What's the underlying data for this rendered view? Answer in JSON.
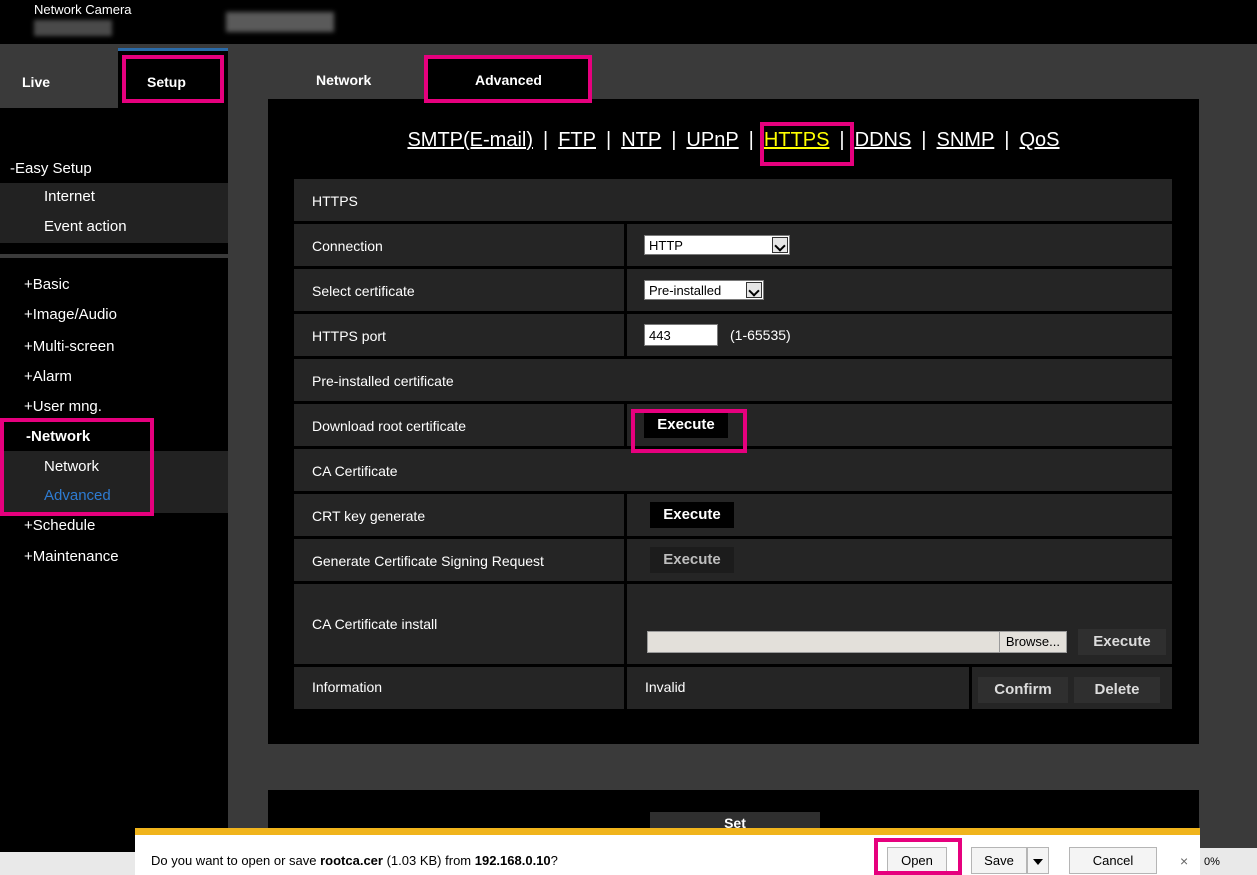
{
  "header": {
    "app_title": "Network Camera"
  },
  "sidebar": {
    "tab_live": "Live",
    "tab_setup": "Setup",
    "easy_setup": "-Easy Setup",
    "easy_items": [
      "Internet",
      "Event action"
    ],
    "menu": [
      "+Basic",
      "+Image/Audio",
      "+Multi-screen",
      "+Alarm",
      "+User mng.",
      "-Network"
    ],
    "network_sub": [
      "Network",
      "Advanced"
    ],
    "menu_after": [
      "+Schedule",
      "+Maintenance"
    ]
  },
  "tabs": {
    "network": "Network",
    "advanced": "Advanced"
  },
  "sublinks": [
    "SMTP(E-mail)",
    "FTP",
    "NTP",
    "UPnP",
    "HTTPS",
    "DDNS",
    "SNMP",
    "QoS"
  ],
  "sublink_separator": "|",
  "https": {
    "section_title": "HTTPS",
    "connection_label": "Connection",
    "connection_value": "HTTP",
    "select_cert_label": "Select certificate",
    "select_cert_value": "Pre-installed",
    "port_label": "HTTPS port",
    "port_value": "443",
    "port_range": "(1-65535)",
    "preinstalled_title": "Pre-installed certificate",
    "download_root_label": "Download root certificate",
    "execute_label": "Execute",
    "ca_title": "CA Certificate",
    "crt_key_label": "CRT key generate",
    "csr_label": "Generate Certificate Signing Request",
    "ca_install_label": "CA Certificate install",
    "browse_label": "Browse...",
    "information_label": "Information",
    "information_value": "Invalid",
    "confirm_label": "Confirm",
    "delete_label": "Delete"
  },
  "set_label": "Set",
  "download_bar": {
    "prefix": "Do you want to open or save ",
    "filename": "rootca.cer",
    "size": " (1.03 KB) from ",
    "host": "192.168.0.10",
    "suffix": "?",
    "open_label": "Open",
    "save_label": "Save",
    "cancel_label": "Cancel",
    "close_glyph": "×"
  },
  "statusbar": {
    "zoom": "0%"
  },
  "colors": {
    "highlight": "#e6007e",
    "active_link": "#ffff00",
    "active_sidebar": "#2e7bd1",
    "notification_bar": "#f0b41c"
  }
}
